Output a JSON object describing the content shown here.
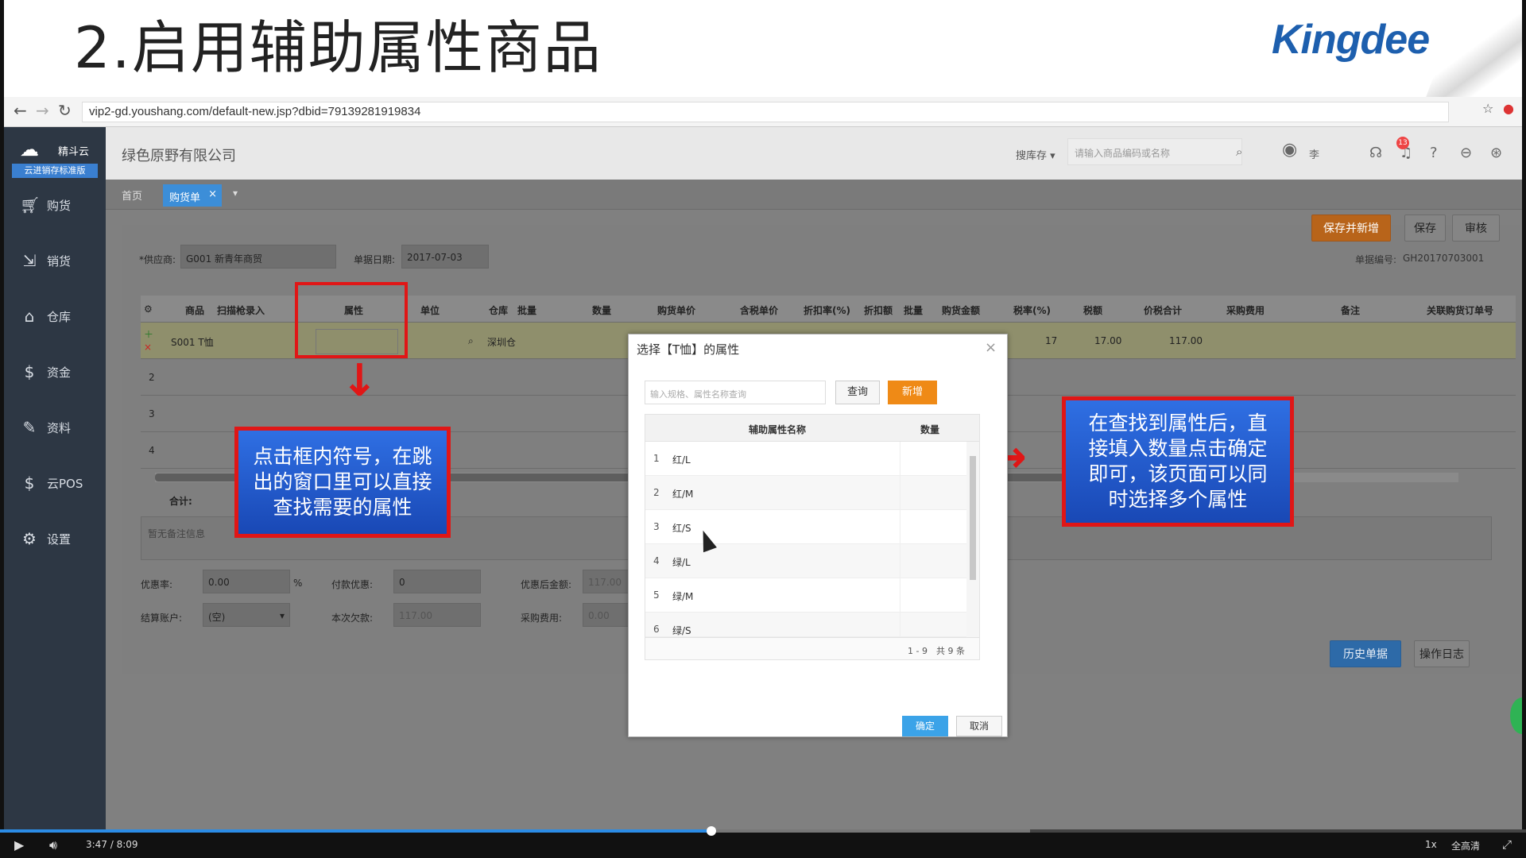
{
  "slide": {
    "title": "2.启用辅助属性商品",
    "logo": "Kingdee"
  },
  "browser": {
    "url": "vip2-gd.youshang.com/default-new.jsp?dbid=79139281919834"
  },
  "app": {
    "brand_name": "精斗云",
    "brand_sub": "云进销存标准版",
    "company": "绿色原野有限公司",
    "top": {
      "search_scope": "搜库存",
      "search_placeholder": "请输入商品编码或名称",
      "user": "李",
      "notif_count": "13"
    },
    "sidebar": [
      {
        "label": "购货",
        "icon": "cart-icon"
      },
      {
        "label": "销货",
        "icon": "sales-icon"
      },
      {
        "label": "仓库",
        "icon": "warehouse-icon"
      },
      {
        "label": "资金",
        "icon": "money-icon"
      },
      {
        "label": "资料",
        "icon": "pen-icon"
      },
      {
        "label": "云POS",
        "icon": "pos-icon"
      },
      {
        "label": "设置",
        "icon": "gear-icon"
      }
    ],
    "tabs": {
      "home": "首页",
      "active": "购货单"
    },
    "form": {
      "supplier_label": "*供应商:",
      "supplier_value": "G001 新青年商贸",
      "date_label": "单据日期:",
      "date_value": "2017-07-03",
      "doc_no_label": "单据编号:",
      "doc_no_value": "GH20170703001"
    },
    "buttons": {
      "save_new": "保存并新增",
      "save": "保存",
      "audit": "审核",
      "history": "历史单据",
      "log": "操作日志"
    },
    "table": {
      "headers": [
        "商品",
        "扫描枪录入",
        "属性",
        "单位",
        "仓库",
        "批量",
        "数量",
        "购货单价",
        "含税单价",
        "折扣率(%)",
        "折扣额",
        "批量",
        "购货金额",
        "税率(%)",
        "税额",
        "价税合计",
        "采购费用",
        "备注",
        "关联购货订单号"
      ],
      "row1": {
        "product": "S001 T恤",
        "warehouse": "深圳仓",
        "tax_rate": "17",
        "tax": "17.00",
        "total": "117.00"
      },
      "row_numbers": [
        "2",
        "3",
        "4"
      ],
      "sum_label": "合计:"
    },
    "remarks_placeholder": "暂无备注信息",
    "bottom": {
      "discount_rate_label": "优惠率:",
      "discount_rate_value": "0.00",
      "percent": "%",
      "pay_discount_label": "付款优惠:",
      "pay_discount_value": "0",
      "after_discount_label": "优惠后金额:",
      "after_discount_value": "117.00",
      "account_label": "结算账户:",
      "account_value": "(空)",
      "arrears_label": "本次欠款:",
      "arrears_value": "117.00",
      "purchase_fee_label": "采购费用:",
      "purchase_fee_value": "0.00"
    }
  },
  "dialog": {
    "title": "选择【T恤】的属性",
    "search_placeholder": "输入规格、属性名称查询",
    "query_button": "查询",
    "new_button": "新增",
    "col_name": "辅助属性名称",
    "col_qty": "数量",
    "rows": [
      "红/L",
      "红/M",
      "红/S",
      "绿/L",
      "绿/M",
      "绿/S"
    ],
    "pager": "1 - 9　共 9 条",
    "ok": "确定",
    "cancel": "取消"
  },
  "callouts": {
    "left": "点击框内符号，在跳出的窗口里可以直接查找需要的属性",
    "right": "在查找到属性后，直接填入数量点击确定即可，该页面可以同时选择多个属性"
  },
  "video": {
    "time": "3:47 / 8:09",
    "speed": "1x",
    "quality": "全高清",
    "progress": 0.466,
    "buffered": 0.675
  }
}
